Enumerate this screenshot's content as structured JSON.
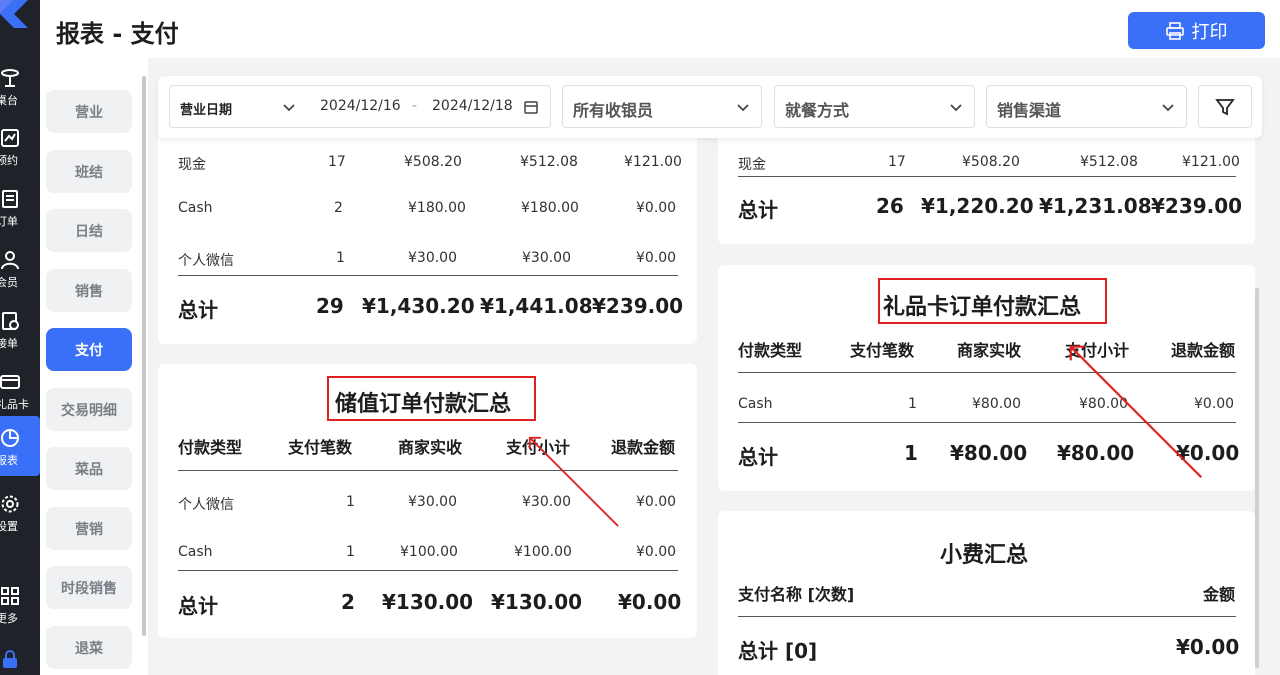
{
  "rail": {
    "items": [
      {
        "label": "桌台",
        "icon": "table-icon"
      },
      {
        "label": "预约",
        "icon": "calendar-chart-icon"
      },
      {
        "label": "订单",
        "icon": "document-icon"
      },
      {
        "label": "会员",
        "icon": "user-icon"
      },
      {
        "label": "接单",
        "icon": "receipt-icon"
      },
      {
        "label": "礼品卡",
        "icon": "card-icon"
      },
      {
        "label": "报表",
        "icon": "pie-chart-icon"
      },
      {
        "label": "设置",
        "icon": "gear-icon"
      },
      {
        "label": "更多",
        "icon": "grid-icon"
      }
    ],
    "active_color": "#3a6ff7"
  },
  "header": {
    "title": "报表 - 支付",
    "print_label": "打印"
  },
  "subnav": {
    "items": [
      "营业",
      "班结",
      "日结",
      "销售",
      "支付",
      "交易明细",
      "菜品",
      "营销",
      "时段销售",
      "退菜"
    ],
    "active": "支付"
  },
  "filters": {
    "date_label": "营业日期",
    "date_start": "2024/12/16",
    "date_sep": "-",
    "date_end": "2024/12/18",
    "cashier": "所有收银员",
    "dining": "就餐方式",
    "channel": "销售渠道"
  },
  "left_top_card": {
    "rows": [
      [
        "现金",
        "17",
        "¥508.20",
        "¥512.08",
        "¥121.00"
      ],
      [
        "Cash",
        "2",
        "¥180.00",
        "¥180.00",
        "¥0.00"
      ],
      [
        "个人微信",
        "1",
        "¥30.00",
        "¥30.00",
        "¥0.00"
      ]
    ],
    "total": [
      "总计",
      "29",
      "¥1,430.20",
      "¥1,441.08",
      "¥239.00"
    ]
  },
  "stored_value_card": {
    "title": "储值订单付款汇总",
    "headers": [
      "付款类型",
      "支付笔数",
      "商家实收",
      "支付小计",
      "退款金额"
    ],
    "rows": [
      [
        "个人微信",
        "1",
        "¥30.00",
        "¥30.00",
        "¥0.00"
      ],
      [
        "Cash",
        "1",
        "¥100.00",
        "¥100.00",
        "¥0.00"
      ]
    ],
    "total": [
      "总计",
      "2",
      "¥130.00",
      "¥130.00",
      "¥0.00"
    ]
  },
  "right_top_card": {
    "rows": [
      [
        "现金",
        "17",
        "¥508.20",
        "¥512.08",
        "¥121.00"
      ]
    ],
    "total": [
      "总计",
      "26",
      "¥1,220.20",
      "¥1,231.08",
      "¥239.00"
    ]
  },
  "gift_card_card": {
    "title": "礼品卡订单付款汇总",
    "headers": [
      "付款类型",
      "支付笔数",
      "商家实收",
      "支付小计",
      "退款金额"
    ],
    "rows": [
      [
        "Cash",
        "1",
        "¥80.00",
        "¥80.00",
        "¥0.00"
      ]
    ],
    "total": [
      "总计",
      "1",
      "¥80.00",
      "¥80.00",
      "¥0.00"
    ]
  },
  "tips_card": {
    "title": "小费汇总",
    "headers": [
      "支付名称 [次数]",
      "金额"
    ],
    "total": [
      "总计 [0]",
      "¥0.00"
    ]
  },
  "colors": {
    "accent": "#3a6ff7",
    "annotation": "#e02020",
    "rail": "#1f2329"
  }
}
